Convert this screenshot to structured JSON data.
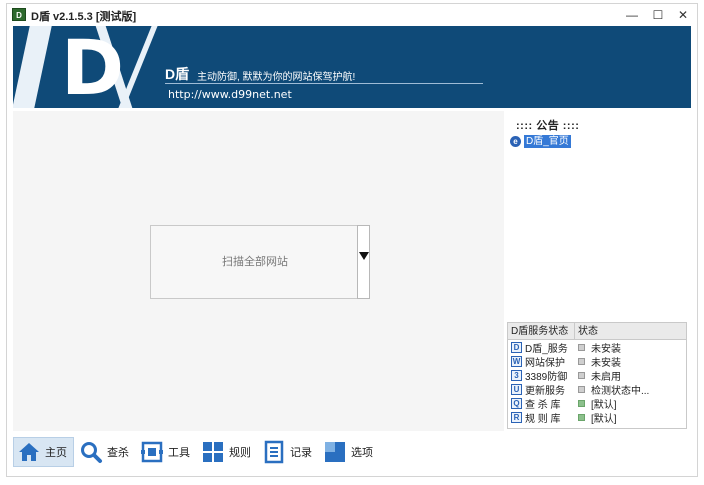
{
  "window": {
    "title": "D盾 v2.1.5.3 [测试版]",
    "app_icon_text": "D"
  },
  "banner": {
    "logo_letter": "D",
    "brand_name": "D盾",
    "slogan": "主动防御, 默默为你的网站保驾护航!",
    "url": "http://www.d99net.net"
  },
  "main": {
    "scan_button_label": "扫描全部网站"
  },
  "side": {
    "notice_title": ":::: 公告 ::::",
    "notice_link": "D盾_官页",
    "status_table": {
      "headers": [
        "D盾服务状态",
        "状态"
      ],
      "rows": [
        {
          "icon": "D",
          "name": "D盾_服务",
          "status": "未安装",
          "indicator": "gray"
        },
        {
          "icon": "W",
          "name": "网站保护",
          "status": "未安装",
          "indicator": "gray"
        },
        {
          "icon": "3",
          "name": "3389防御",
          "status": "未启用",
          "indicator": "gray"
        },
        {
          "icon": "U",
          "name": "更新服务",
          "status": "检测状态中...",
          "indicator": "gray"
        },
        {
          "icon": "Q",
          "name": "查 杀 库",
          "status": "[默认]",
          "indicator": "green"
        },
        {
          "icon": "R",
          "name": "规 则 库",
          "status": "[默认]",
          "indicator": "green"
        }
      ]
    }
  },
  "toolbar": {
    "items": [
      {
        "label": "主页",
        "icon": "home-icon"
      },
      {
        "label": "查杀",
        "icon": "search-icon"
      },
      {
        "label": "工具",
        "icon": "tools-icon"
      },
      {
        "label": "规则",
        "icon": "rules-icon"
      },
      {
        "label": "记录",
        "icon": "log-icon"
      },
      {
        "label": "选项",
        "icon": "options-icon"
      }
    ]
  },
  "colors": {
    "banner_bg": "#0f4a78",
    "accent_blue": "#2a62b5",
    "link_highlight": "#3579d6"
  }
}
